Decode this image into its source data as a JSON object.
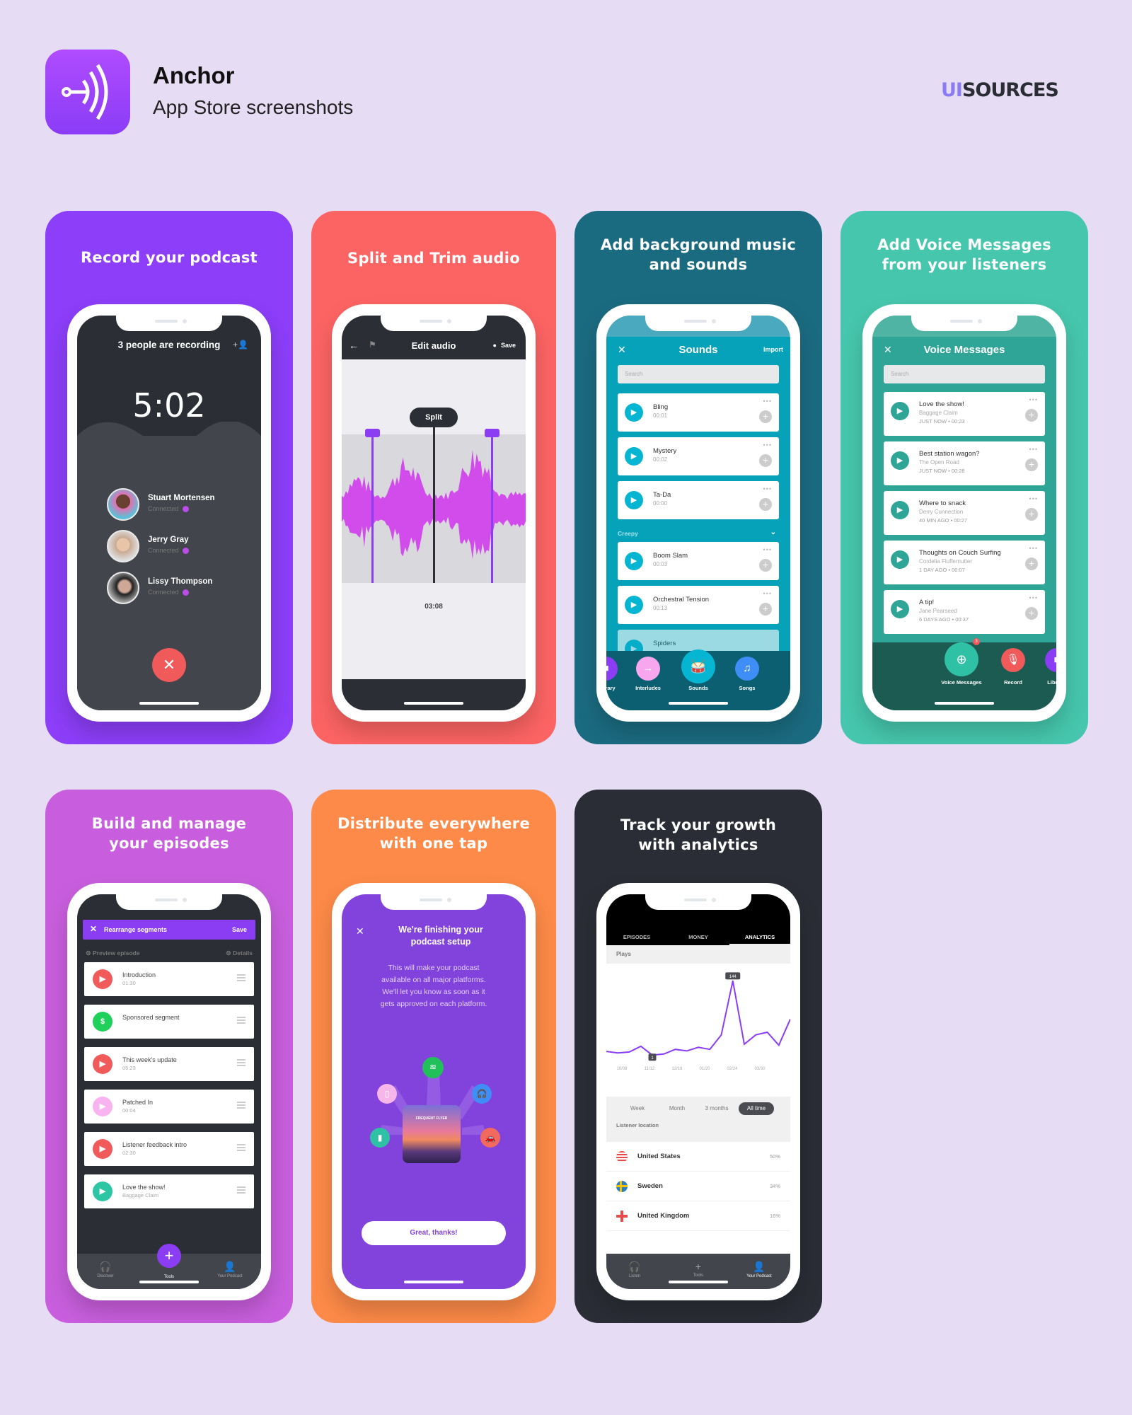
{
  "header": {
    "app_name": "Anchor",
    "subtitle": "App Store screenshots",
    "brand_prefix": "UI",
    "brand_suffix": "SOURCES"
  },
  "colors": {
    "page_bg": "#e6dcf4",
    "brand_purple": "#8c7cf4",
    "card_record": "#8c3ef8",
    "card_split": "#fc6463",
    "card_sounds": "#1b6b80",
    "card_voice": "#46c7ad",
    "card_episodes": "#c85edd",
    "card_distribute": "#fd8a48",
    "card_analytics": "#2a2d35"
  },
  "cards": [
    {
      "title": "Record your podcast",
      "screen": {
        "header": "3 people are recording",
        "timer": "5:02",
        "people": [
          {
            "name": "Stuart Mortensen",
            "status": "Connected"
          },
          {
            "name": "Jerry Gray",
            "status": "Connected"
          },
          {
            "name": "Lissy Thompson",
            "status": "Connected"
          }
        ],
        "end_icon": "✕"
      }
    },
    {
      "title": "Split and Trim audio",
      "screen": {
        "title": "Edit audio",
        "save": "Save",
        "split_label": "Split",
        "time": "03:08"
      }
    },
    {
      "title": "Add background music\nand sounds",
      "screen": {
        "title": "Sounds",
        "import": "Import",
        "search_placeholder": "Search",
        "items": [
          {
            "name": "Bling",
            "duration": "00:01"
          },
          {
            "name": "Mystery",
            "duration": "00:02"
          },
          {
            "name": "Ta-Da",
            "duration": "00:00"
          }
        ],
        "category": "Creepy",
        "category_items": [
          {
            "name": "Boom Slam",
            "duration": "00:03"
          },
          {
            "name": "Orchestral Tension",
            "duration": "00:13"
          },
          {
            "name": "Spiders",
            "duration": ""
          }
        ],
        "dock": [
          {
            "label": "Library"
          },
          {
            "label": "Interludes"
          },
          {
            "label": "Sounds"
          },
          {
            "label": "Songs"
          }
        ]
      }
    },
    {
      "title": "Add Voice Messages\nfrom your listeners",
      "screen": {
        "title": "Voice Messages",
        "search_placeholder": "Search",
        "messages": [
          {
            "title": "Love the show!",
            "author": "Baggage Claim",
            "meta": "JUST NOW • 00:23"
          },
          {
            "title": "Best station wagon?",
            "author": "The Open Road",
            "meta": "JUST NOW • 00:28"
          },
          {
            "title": "Where to snack",
            "author": "Derry Connection",
            "meta": "40 MIN AGO • 00:27"
          },
          {
            "title": "Thoughts on Couch Surfing",
            "author": "Cordelia Fluffernutter",
            "meta": "1 DAY AGO • 00:07"
          },
          {
            "title": "A tip!",
            "author": "Jane Pearseed",
            "meta": "6 DAYS AGO • 00:37"
          }
        ],
        "dock": [
          {
            "label": "Voice Messages",
            "badge": "3"
          },
          {
            "label": "Record"
          },
          {
            "label": "Library"
          }
        ]
      }
    },
    {
      "title": "Build and manage\nyour episodes",
      "screen": {
        "bar_title": "Rearrange segments",
        "save": "Save",
        "preview": "Preview episode",
        "details": "Details",
        "segments": [
          {
            "name": "Introduction",
            "duration": "01:30",
            "color": "#f05a5b",
            "icon": "▶"
          },
          {
            "name": "Sponsored segment",
            "duration": "",
            "color": "#1fd15a",
            "icon": "$"
          },
          {
            "name": "This week's update",
            "duration": "05:23",
            "color": "#f05a5b",
            "icon": "▶"
          },
          {
            "name": "Patched In",
            "duration": "00:04",
            "color": "#f8b3f0",
            "icon": "▶"
          },
          {
            "name": "Listener feedback intro",
            "duration": "02:30",
            "color": "#f05a5b",
            "icon": "▶"
          },
          {
            "name": "Love the show!",
            "duration": "Baggage Claim",
            "color": "#2cc6a5",
            "icon": "▶"
          }
        ],
        "tabs": [
          {
            "label": "Discover"
          },
          {
            "label": "Tools"
          },
          {
            "label": "Your Podcast"
          }
        ]
      }
    },
    {
      "title": "Distribute everywhere\nwith one tap",
      "screen": {
        "title": "We're finishing your\npodcast setup",
        "body": "This will make your podcast\navailable on all major platforms.\nWe'll let you know as soon as it\ngets approved on each platform.",
        "cover_title": "FREQUENT FLYER",
        "button": "Great, thanks!"
      }
    },
    {
      "title": "Track your growth\nwith analytics",
      "screen": {
        "tabs": [
          "EPISODES",
          "MONEY",
          "ANALYTICS"
        ],
        "active_tab": "ANALYTICS",
        "plays_label": "Plays",
        "ranges": [
          "Week",
          "Month",
          "3 months",
          "All time"
        ],
        "active_range": "All time",
        "location_label": "Listener location",
        "locations": [
          {
            "country": "United States",
            "percent": "50%"
          },
          {
            "country": "Sweden",
            "percent": "34%"
          },
          {
            "country": "United Kingdom",
            "percent": "16%"
          }
        ],
        "bottom_tabs": [
          {
            "label": "Listen"
          },
          {
            "label": "Tools"
          },
          {
            "label": "Your Podcast"
          }
        ]
      }
    }
  ],
  "chart_data": {
    "type": "line",
    "title": "Plays",
    "x_tick_labels": [
      "10/08",
      "11/12",
      "12/16",
      "01/20",
      "02/24",
      "03/30"
    ],
    "values": [
      8,
      5,
      7,
      18,
      1,
      3,
      12,
      9,
      16,
      12,
      40,
      144,
      22,
      40,
      45,
      20,
      70
    ],
    "annotations": [
      {
        "label": "1",
        "index": 4
      },
      {
        "label": "144",
        "index": 11
      }
    ],
    "ylim": [
      0,
      150
    ],
    "grid": false,
    "color": "#8a3df3"
  }
}
